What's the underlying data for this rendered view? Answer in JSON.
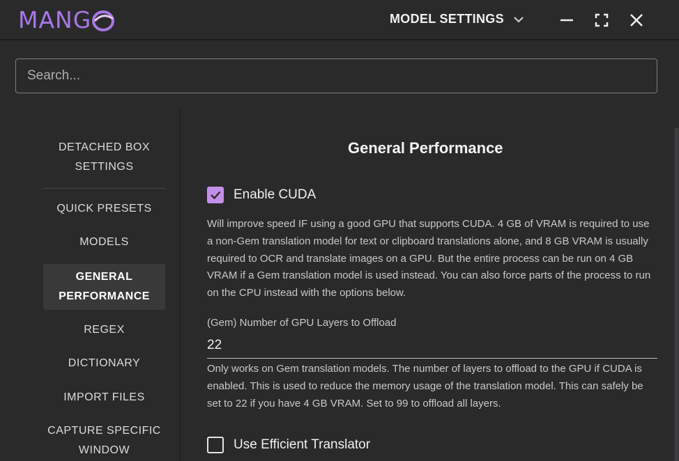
{
  "app": {
    "logo_text": "MANG",
    "accent": "#c38fe8"
  },
  "header": {
    "menu_title": "MODEL SETTINGS"
  },
  "search": {
    "placeholder": "Search..."
  },
  "sidebar": {
    "items": [
      {
        "line1": "DETACHED BOX",
        "line2": "SETTINGS"
      },
      {
        "line1": "QUICK PRESETS"
      },
      {
        "line1": "MODELS"
      },
      {
        "line1": "GENERAL",
        "line2": "PERFORMANCE",
        "active": true
      },
      {
        "line1": "REGEX"
      },
      {
        "line1": "DICTIONARY"
      },
      {
        "line1": "IMPORT FILES"
      },
      {
        "line1": "CAPTURE SPECIFIC",
        "line2": "WINDOW"
      }
    ]
  },
  "main": {
    "section_title": "General Performance",
    "enable_cuda": {
      "label": "Enable CUDA",
      "checked": true,
      "description": "Will improve speed IF using a good GPU that supports CUDA. 4 GB of VRAM is required to use a non-Gem translation model for text or clipboard translations alone, and 8 GB VRAM is usually required to OCR and translate images on a GPU. But the entire process can be run on 4 GB VRAM if a Gem translation model is used instead. You can also force parts of the process to run on the CPU instead with the options below."
    },
    "gpu_layers": {
      "label": "(Gem) Number of GPU Layers to Offload",
      "value": "22",
      "description": "Only works on Gem translation models. The number of layers to offload to the GPU if CUDA is enabled. This is used to reduce the memory usage of the translation model. This can safely be set to 22 if you have 4 GB VRAM. Set to 99 to offload all layers."
    },
    "efficient_translator": {
      "label": "Use Efficient Translator",
      "checked": false
    }
  }
}
